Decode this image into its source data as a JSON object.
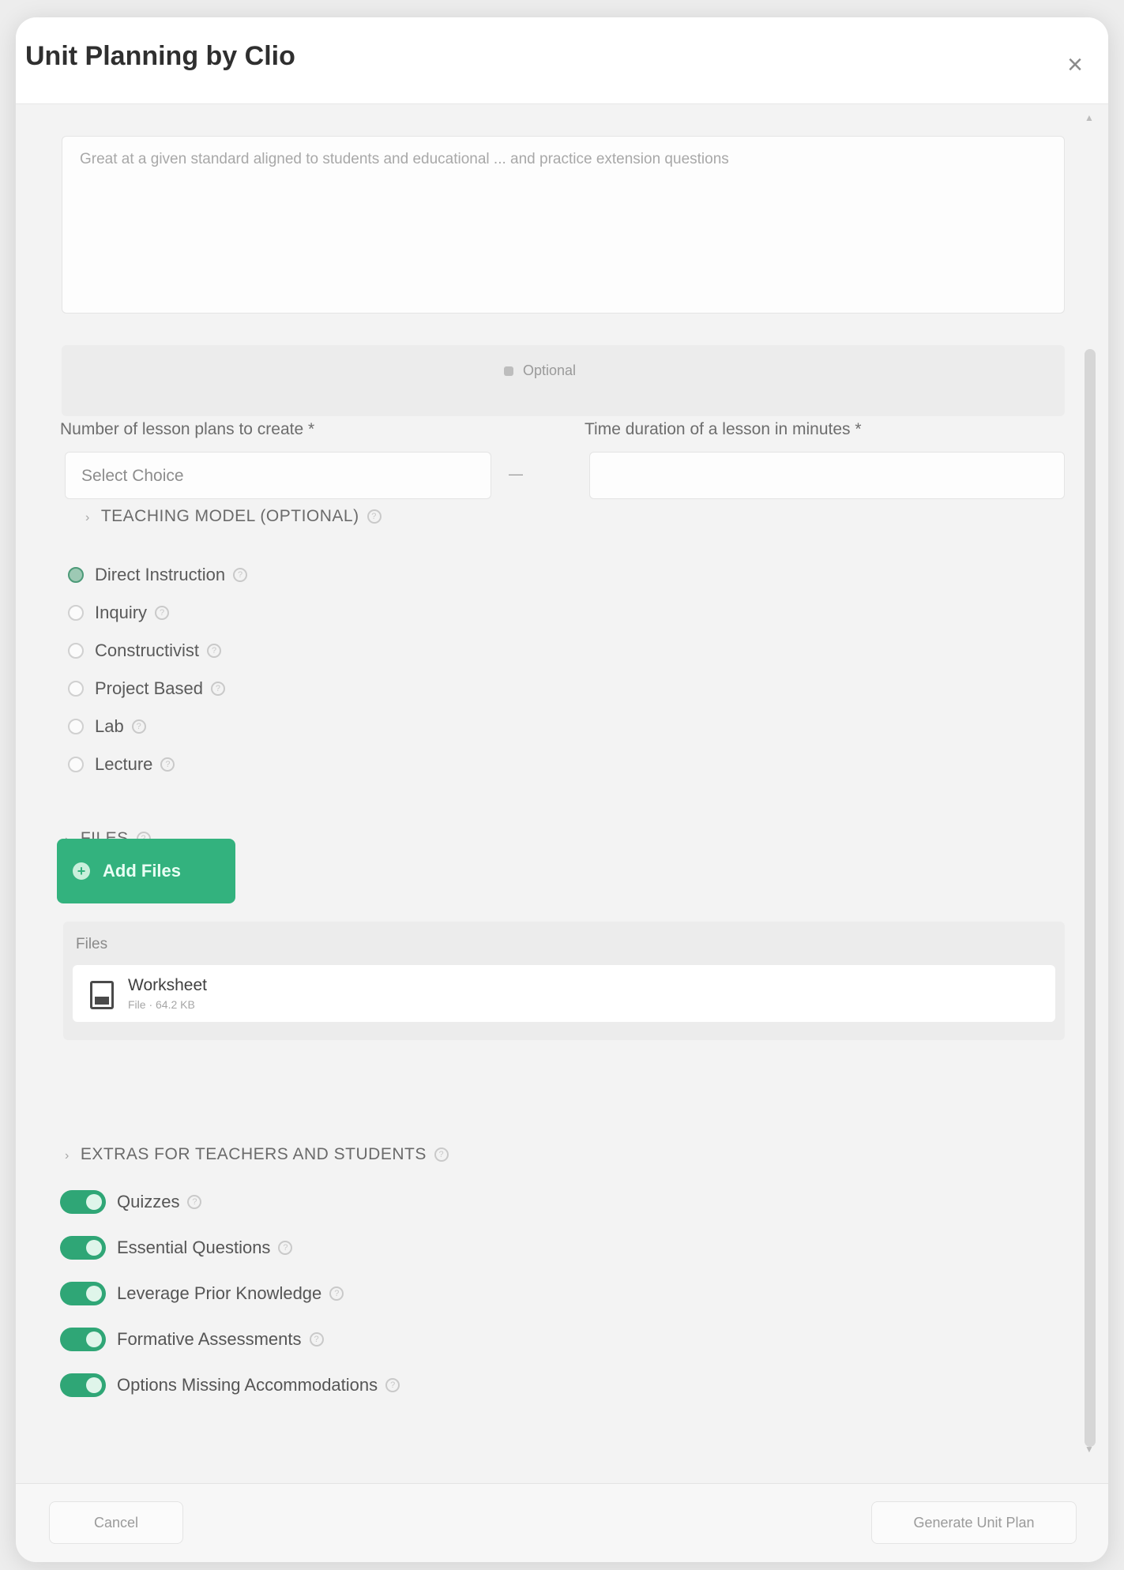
{
  "modal": {
    "title": "Unit Planning by Clio",
    "close_label": "×"
  },
  "description": {
    "placeholder": "Great at a given standard aligned to students and educational ... and practice extension questions"
  },
  "optional_divider": {
    "label": "Optional"
  },
  "fields": {
    "lessons_label": "Number of lesson plans to create *",
    "lessons_value": "Select Choice",
    "duration_label": "Time duration of a lesson in minutes *",
    "duration_value": ""
  },
  "framework_section": {
    "heading": "TEACHING MODEL (OPTIONAL)",
    "options": [
      {
        "label": "Direct Instruction",
        "checked": true
      },
      {
        "label": "Inquiry",
        "checked": false
      },
      {
        "label": "Constructivist",
        "checked": false
      },
      {
        "label": "Project Based",
        "checked": false
      },
      {
        "label": "Lab",
        "checked": false
      },
      {
        "label": "Lecture",
        "checked": false
      }
    ]
  },
  "files_section": {
    "heading": "FILES",
    "add_button": "Add Files",
    "panel_label": "Files",
    "file_name": "Worksheet",
    "file_meta": "File · 64.2 KB"
  },
  "toggles_section": {
    "heading": "EXTRAS FOR TEACHERS AND STUDENTS",
    "items": [
      {
        "label": "Quizzes",
        "on": true
      },
      {
        "label": "Essential Questions",
        "on": true
      },
      {
        "label": "Leverage Prior Knowledge",
        "on": true
      },
      {
        "label": "Formative Assessments",
        "on": true
      },
      {
        "label": "Options Missing Accommodations",
        "on": true
      }
    ]
  },
  "footer": {
    "cancel_label": "Cancel",
    "submit_label": "Generate Unit Plan"
  },
  "colors": {
    "accent": "#33b27e",
    "toggle_on": "#2fa676",
    "background": "#f3f3f3"
  },
  "icons": {
    "close": "close-icon",
    "help": "question-icon",
    "plus": "plus-icon",
    "file": "file-icon",
    "chevron": "chevron-icon"
  }
}
